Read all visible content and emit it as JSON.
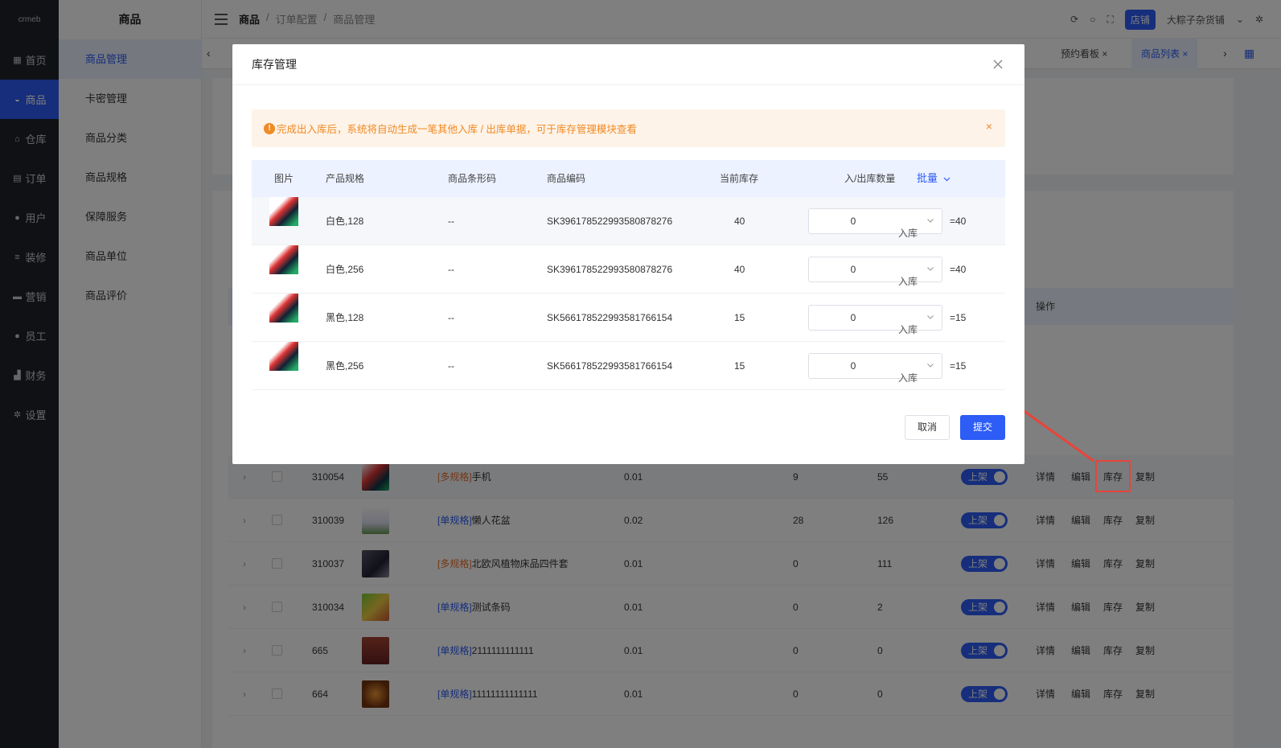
{
  "nav": {
    "logo": "crmeb",
    "items": [
      {
        "label": "首页",
        "icon": "grid-icon"
      },
      {
        "label": "商品",
        "icon": "bag-icon"
      },
      {
        "label": "仓库",
        "icon": "warehouse-icon"
      },
      {
        "label": "订单",
        "icon": "clipboard-icon"
      },
      {
        "label": "用户",
        "icon": "user-icon"
      },
      {
        "label": "装修",
        "icon": "sliders-icon"
      },
      {
        "label": "营销",
        "icon": "message-icon"
      },
      {
        "label": "员工",
        "icon": "user-icon"
      },
      {
        "label": "财务",
        "icon": "chart-icon"
      },
      {
        "label": "设置",
        "icon": "gear-icon"
      }
    ]
  },
  "subnav": {
    "title": "商品",
    "items": [
      "商品管理",
      "卡密管理",
      "商品分类",
      "商品规格",
      "保障服务",
      "商品单位",
      "商品评价"
    ]
  },
  "header": {
    "breadcrumb": [
      "商品",
      "/",
      "订单配置",
      "/",
      "商品管理"
    ],
    "store_badge": "店铺",
    "store_name": "大粽子杂货铺"
  },
  "tabs": [
    "预约看板",
    "商品列表"
  ],
  "table": {
    "ops_header": "操作",
    "status_label": "上架",
    "ops": [
      "详情",
      "编辑",
      "库存",
      "复制"
    ],
    "rows": [
      {
        "id": "310054",
        "tag": "[多规格]",
        "name": "手机",
        "price": "0.01",
        "sales": "9",
        "stock": "55"
      },
      {
        "id": "310039",
        "tag": "[单规格]",
        "name": "懒人花盆",
        "price": "0.02",
        "sales": "28",
        "stock": "126"
      },
      {
        "id": "310037",
        "tag": "[多规格]",
        "name": "北欧风植物床品四件套",
        "price": "0.01",
        "sales": "0",
        "stock": "111"
      },
      {
        "id": "310034",
        "tag": "[单规格]",
        "name": "测试条码",
        "price": "0.01",
        "sales": "0",
        "stock": "2"
      },
      {
        "id": "665",
        "tag": "[单规格]",
        "name": "2111111111111",
        "price": "0.01",
        "sales": "0",
        "stock": "0"
      },
      {
        "id": "664",
        "tag": "[单规格]",
        "name": "11111111111111",
        "price": "0.01",
        "sales": "0",
        "stock": "0"
      }
    ]
  },
  "modal": {
    "title": "库存管理",
    "notice": "完成出入库后，系统将自动生成一笔其他入库 / 出库单据，可于库存管理模块查看",
    "columns": [
      "图片",
      "产品规格",
      "商品条形码",
      "商品编码",
      "当前库存",
      "入/出库数量",
      "批量"
    ],
    "rows": [
      {
        "spec": "白色,128",
        "barcode": "--",
        "code": "SK3961785229935808 78276",
        "stock": "40",
        "qty": "0",
        "type": "入库",
        "result": "=40"
      },
      {
        "spec": "白色,256",
        "barcode": "--",
        "code": "SK396178522993580878276",
        "stock": "40",
        "qty": "0",
        "type": "入库",
        "result": "=40"
      },
      {
        "spec": "黑色,128",
        "barcode": "--",
        "code": "SK566178522993581766154",
        "stock": "15",
        "qty": "0",
        "type": "入库",
        "result": "=15"
      },
      {
        "spec": "黑色,256",
        "barcode": "--",
        "code": "SK566178522993581766154",
        "stock": "15",
        "qty": "0",
        "type": "入库",
        "result": "=15"
      }
    ],
    "cancel_label": "取消",
    "submit_label": "提交"
  },
  "colors": {
    "accent": "#2d5cf6",
    "warning": "#f08a24",
    "highlight": "#e8443a"
  }
}
